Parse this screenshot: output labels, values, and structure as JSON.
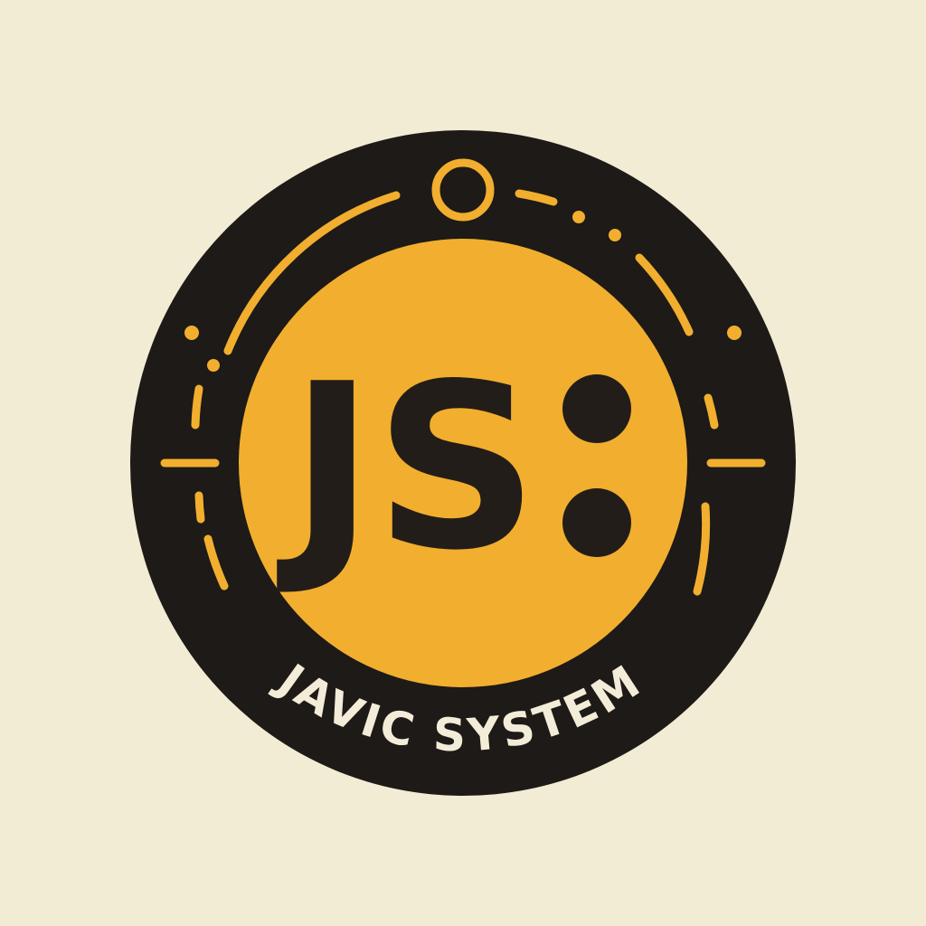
{
  "logo": {
    "monogram": "JS",
    "tagline": "JAVIC SYSTEM",
    "colors": {
      "background": "#f2ecd5",
      "outer_ring": "#1d1a17",
      "inner_disc": "#f2ae2e",
      "monogram": "#221d18",
      "tagline": "#f3ecd8",
      "ornament": "#f2ae2e"
    }
  }
}
